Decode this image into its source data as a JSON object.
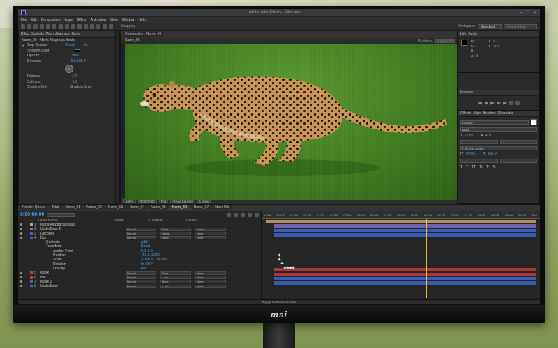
{
  "window": {
    "title": "Adobe After Effects - Files.aep",
    "controls": [
      "–",
      "□",
      "✕"
    ]
  },
  "menu": [
    "File",
    "Edit",
    "Composition",
    "Layer",
    "Effect",
    "Animation",
    "View",
    "Window",
    "Help"
  ],
  "toolbar": {
    "snapping": "Snapping",
    "workspace_label": "Workspace:",
    "workspace_value": "Standard",
    "search_placeholder": "Search Help"
  },
  "effect_controls": {
    "tab": "Effect Controls: Marla Allagracia Beats",
    "subtitle": "Name_06 • Marla Allagracia Beats",
    "effect": {
      "name": "Drop Shadow",
      "reset": "Reset",
      "about": "Ab"
    },
    "rows": [
      {
        "label": "Shadow Color",
        "value": ""
      },
      {
        "label": "Opacity",
        "value": "90%"
      },
      {
        "label": "Direction",
        "value": "0x+135.0°"
      },
      {
        "label": "Distance",
        "value": "5.0"
      },
      {
        "label": "Softness",
        "value": "5.0"
      },
      {
        "label": "Shadow Only",
        "value": "Shadow Only"
      }
    ]
  },
  "composition": {
    "tab": "Composition: Name_06",
    "subtab": "Name_06",
    "renderer_label": "Renderer:",
    "renderer_value": "Classic 3D",
    "viewbar": [
      "100%",
      "0:00:00:00",
      "Full",
      "Active Camera",
      "1 View"
    ]
  },
  "info_panel": {
    "tabs": [
      "Info",
      "Audio"
    ],
    "values": [
      "R :",
      "G :",
      "B :",
      "A : 0",
      "X : 0",
      "Y : 961"
    ]
  },
  "preview_panel": {
    "tab": "Preview"
  },
  "character_panel": {
    "tabs": [
      "Effects",
      "Align",
      "Brushes",
      "Character"
    ],
    "font": "Roboto",
    "style": "Bold",
    "size": "12 px",
    "leading": "Auto",
    "stroke": "Fill Over Stroke",
    "scale_v": "100 %",
    "scale_h": "100 %"
  },
  "timeline": {
    "tabs": [
      "Render Queue",
      "Total",
      "Name_01",
      "Name_02",
      "Name_03",
      "Name_04",
      "Name_05",
      "Name_06",
      "Name_07",
      "Main Title"
    ],
    "timecode": "0:00:00:00",
    "columns": [
      "Layer Name",
      "Mode",
      "T TrkMat",
      "Parent"
    ],
    "layers": [
      {
        "num": "1",
        "name": "Marla Allagracia Beats",
        "color": "#c6a56a"
      },
      {
        "num": "2",
        "name": "UnderBase 2",
        "color": "#7c6bc9",
        "mode": "Normal",
        "trk": "None",
        "parent": "None"
      },
      {
        "num": "3",
        "name": "Decorete",
        "color": "#3f66c9",
        "mode": "Normal",
        "trk": "Alpha",
        "parent": "None"
      },
      {
        "num": "4",
        "name": "Dot",
        "color": "#3f66c9",
        "mode": "Normal",
        "trk": "None",
        "parent": "None"
      },
      {
        "num": "",
        "name": "Contents",
        "color": "",
        "right": "Add:"
      },
      {
        "num": "",
        "name": "Transform",
        "color": "",
        "right": "Reset"
      },
      {
        "num": "",
        "name": "Anchor Point",
        "color": "",
        "right": "0.0, 0.0"
      },
      {
        "num": "",
        "name": "Position",
        "color": "",
        "right": "463.6, 328.0"
      },
      {
        "num": "",
        "name": "Scale",
        "color": "",
        "right": "∞ 100.0, 100.0%"
      },
      {
        "num": "",
        "name": "Rotation",
        "color": "",
        "right": "0x+0.0°"
      },
      {
        "num": "",
        "name": "Opacity",
        "color": "",
        "right": "0%"
      },
      {
        "num": "5",
        "name": "Mask",
        "color": "#c23b3b",
        "mode": "Normal",
        "trk": "None",
        "parent": "None"
      },
      {
        "num": "6",
        "name": "Bat",
        "color": "#c23b3b",
        "mode": "Normal",
        "trk": "A.Inv",
        "parent": "None"
      },
      {
        "num": "7",
        "name": "Mask 2",
        "color": "#3f66c9",
        "mode": "Normal",
        "trk": "None",
        "parent": "None"
      },
      {
        "num": "8",
        "name": "UnderBase",
        "color": "#3f66c9",
        "mode": "Normal",
        "trk": "A.Inv",
        "parent": "None"
      }
    ],
    "ruler": [
      "0:00f",
      "00:15f",
      "01:00f",
      "01:15f",
      "02:00f",
      "02:15f",
      "03:00f",
      "03:15f",
      "04:00f",
      "04:15f",
      "05:00f",
      "05:15f",
      "06:00f",
      "06:15f",
      "07:00f",
      "07:15f",
      "08:00f",
      "08:15f",
      "09:00f",
      "09:15f",
      "10:0"
    ],
    "footer": "Toggle Switches / Modes"
  },
  "monitor": {
    "brand": "msi"
  },
  "colors": {
    "accent": "#4a9fe8",
    "timecode": "#4aa0ee",
    "playhead": "#e5b83a"
  }
}
